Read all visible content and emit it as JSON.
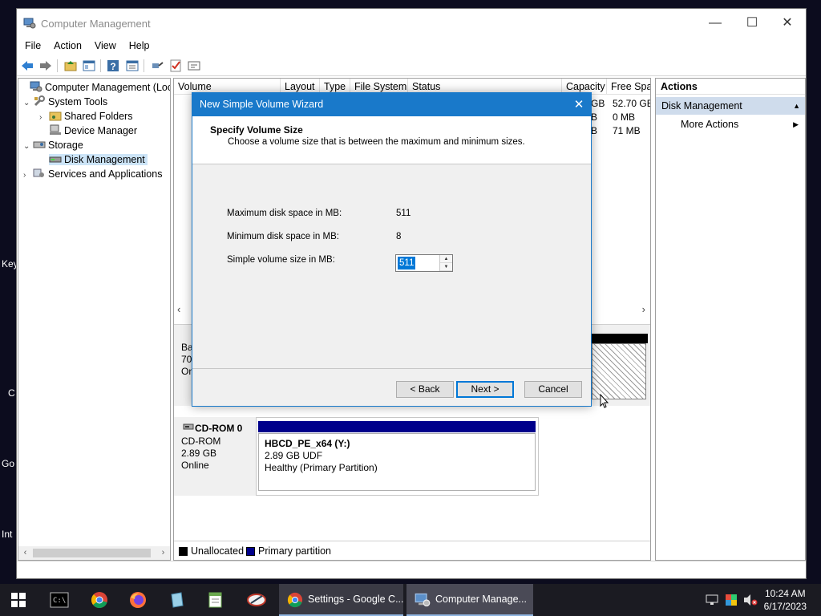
{
  "desktop": {
    "labels": [
      "Key",
      "C",
      "Go",
      "Int"
    ]
  },
  "window": {
    "title": "Computer Management",
    "controls": {
      "minimize": "—",
      "maximize": "☐",
      "close": "✕"
    }
  },
  "menu": [
    "File",
    "Action",
    "View",
    "Help"
  ],
  "tree": {
    "items": [
      {
        "label": "Computer Management (Local",
        "twisty": ""
      },
      {
        "label": "System Tools",
        "twisty": "⌄"
      },
      {
        "label": "Shared Folders",
        "twisty": "›"
      },
      {
        "label": "Device Manager",
        "twisty": ""
      },
      {
        "label": "Storage",
        "twisty": "⌄"
      },
      {
        "label": "Disk Management",
        "twisty": ""
      },
      {
        "label": "Services and Applications",
        "twisty": "›"
      }
    ]
  },
  "volume_list": {
    "columns": [
      "Volume",
      "Layout",
      "Type",
      "File System",
      "Status",
      "Capacity",
      "Free Spa"
    ],
    "capacity_fragments": [
      "GB",
      "B",
      "B"
    ],
    "free_space": [
      "52.70 GB",
      "0 MB",
      "71 MB"
    ]
  },
  "disk_fragments": [
    "Ba",
    "70.",
    "On"
  ],
  "cdrom": {
    "name": "CD-ROM 0",
    "type": "CD-ROM",
    "size": "2.89 GB",
    "status": "Online",
    "partition_name": "HBCD_PE_x64  (Y:)",
    "partition_size": "2.89 GB UDF",
    "partition_status": "Healthy (Primary Partition)"
  },
  "legend": [
    {
      "label": "Unallocated",
      "color": "#000000"
    },
    {
      "label": "Primary partition",
      "color": "#00008b"
    }
  ],
  "actions": {
    "header": "Actions",
    "selected": "Disk Management",
    "items": [
      "More Actions"
    ]
  },
  "dialog": {
    "title": "New Simple Volume Wizard",
    "close": "✕",
    "heading": "Specify Volume Size",
    "subheading": "Choose a volume size that is between the maximum and minimum sizes.",
    "fields": [
      {
        "label": "Maximum disk space in MB:",
        "value": "511"
      },
      {
        "label": "Minimum disk space in MB:",
        "value": "8"
      },
      {
        "label": "Simple volume size in MB:",
        "value": "511"
      }
    ],
    "buttons": {
      "back": "< Back",
      "next": "Next >",
      "cancel": "Cancel"
    }
  },
  "taskbar": {
    "tasks": [
      {
        "label": "Settings - Google C...",
        "icon": "chrome-icon"
      },
      {
        "label": "Computer Manage...",
        "icon": "computer-management-icon"
      }
    ],
    "clock": {
      "time": "10:24 AM",
      "date": "6/17/2023"
    }
  },
  "colors": {
    "dialog_title": "#1979ca",
    "selection": "#cce4f7",
    "primary_partition": "#00008b"
  }
}
